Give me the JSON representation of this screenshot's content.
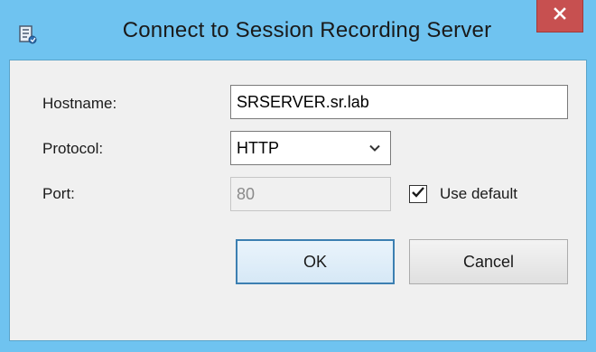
{
  "window": {
    "title": "Connect to Session Recording Server",
    "app_icon": "session-recording-icon",
    "close_icon": "close-icon",
    "colors": {
      "frame": "#6fc3f0",
      "close": "#c75050",
      "content": "#f0f0f0"
    }
  },
  "form": {
    "hostname_label": "Hostname:",
    "hostname_value": "SRSERVER.sr.lab",
    "protocol_label": "Protocol:",
    "protocol_value": "HTTP",
    "port_label": "Port:",
    "port_value": "80",
    "use_default_label": "Use default",
    "use_default_checked": true
  },
  "buttons": {
    "ok_label": "OK",
    "cancel_label": "Cancel"
  }
}
